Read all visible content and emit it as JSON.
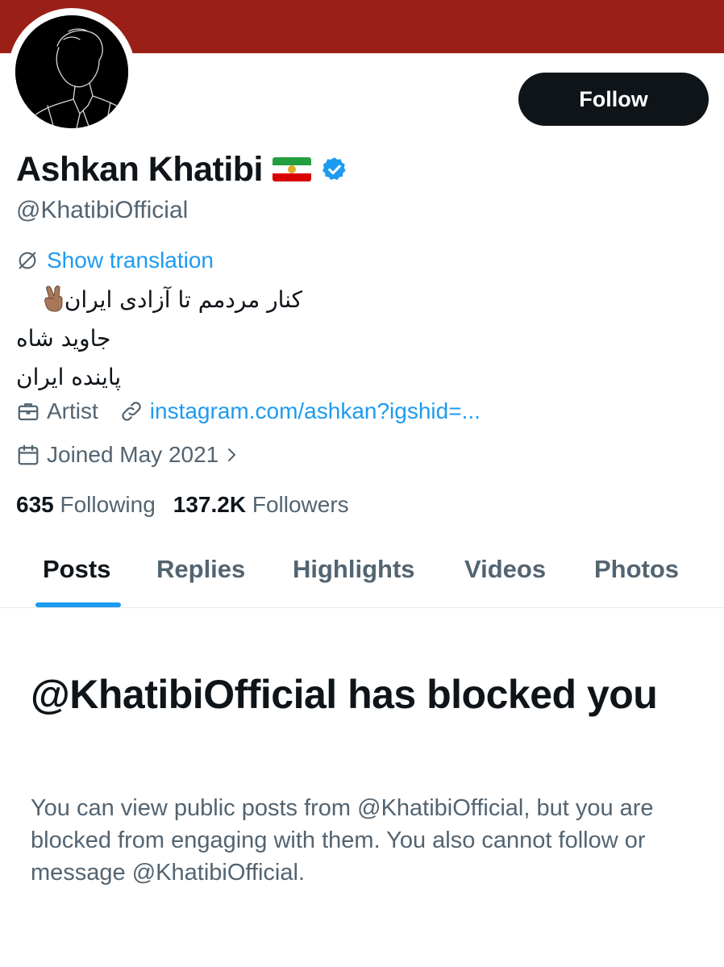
{
  "profile": {
    "display_name": "Ashkan Khatibi",
    "handle": "@KhatibiOfficial",
    "flag_icon": "iran-lion-and-sun-flag-icon",
    "verified_icon": "verified-badge-icon",
    "verified_color": "#1d9bf0",
    "banner_color": "#9a1f16"
  },
  "actions": {
    "follow_label": "Follow"
  },
  "bio": {
    "translate_label": "Show translation",
    "lines": [
      "کنار مردمم تا آزادی ایران",
      "جاوید شاه",
      "پاینده ایران"
    ],
    "emoji": "victory-hand-emoji"
  },
  "meta": {
    "profession": "Artist",
    "link": "instagram.com/ashkan?igshid=...",
    "joined": "Joined May 2021"
  },
  "stats": {
    "following_count": "635",
    "following_label": "Following",
    "followers_count": "137.2K",
    "followers_label": "Followers"
  },
  "tabs": [
    {
      "label": "Posts",
      "active": true
    },
    {
      "label": "Replies",
      "active": false
    },
    {
      "label": "Highlights",
      "active": false
    },
    {
      "label": "Videos",
      "active": false
    },
    {
      "label": "Photos",
      "active": false
    }
  ],
  "blocked": {
    "title": "@KhatibiOfficial has blocked you",
    "description": "You can view public posts from @KhatibiOfficial, but you are blocked from engaging with them. You also cannot follow or message @KhatibiOfficial."
  },
  "colors": {
    "accent": "#1d9bf0",
    "text_primary": "#0f1419",
    "text_secondary": "#536471"
  }
}
